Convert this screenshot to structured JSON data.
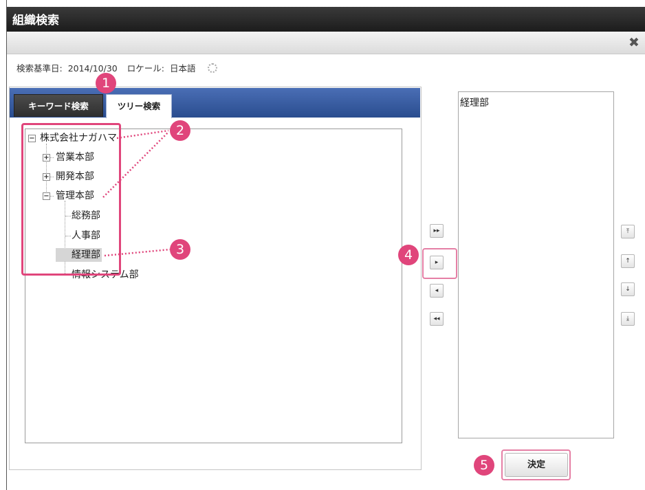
{
  "dialog": {
    "title": "組織検索",
    "close_icon": "close-x-icon"
  },
  "info": {
    "base_date_label": "検索基準日:",
    "base_date": "2014/10/30",
    "locale_label": "ロケール:",
    "locale": "日本語",
    "settings_icon": "gear-icon"
  },
  "tabs": [
    {
      "label": "キーワード検索",
      "active": false
    },
    {
      "label": "ツリー検索",
      "active": true
    }
  ],
  "tree": {
    "root": "株式会社ナガハマ",
    "nodes": [
      {
        "label": "営業本部",
        "state": "collapsed"
      },
      {
        "label": "開発本部",
        "state": "collapsed"
      },
      {
        "label": "管理本部",
        "state": "expanded"
      }
    ],
    "children": [
      "総務部",
      "人事部",
      "経理部",
      "情報システム部"
    ],
    "selected": "経理部"
  },
  "transfer_buttons": [
    {
      "name": "add-all-button",
      "glyph": "▸▸"
    },
    {
      "name": "add-button",
      "glyph": "▸"
    },
    {
      "name": "remove-button",
      "glyph": "◂"
    },
    {
      "name": "remove-all-button",
      "glyph": "◂◂"
    }
  ],
  "order_buttons": [
    {
      "name": "move-top-button",
      "glyph": "⤒"
    },
    {
      "name": "move-up-button",
      "glyph": "↑"
    },
    {
      "name": "move-down-button",
      "glyph": "↓"
    },
    {
      "name": "move-bottom-button",
      "glyph": "⤓"
    }
  ],
  "selected_list": [
    "経理部"
  ],
  "decide_label": "決定",
  "callouts": [
    "1",
    "2",
    "3",
    "4",
    "5"
  ],
  "colors": {
    "accent": "#e0457b",
    "tab_bar": "#2f5398",
    "title_bar": "#2a2a2a"
  }
}
